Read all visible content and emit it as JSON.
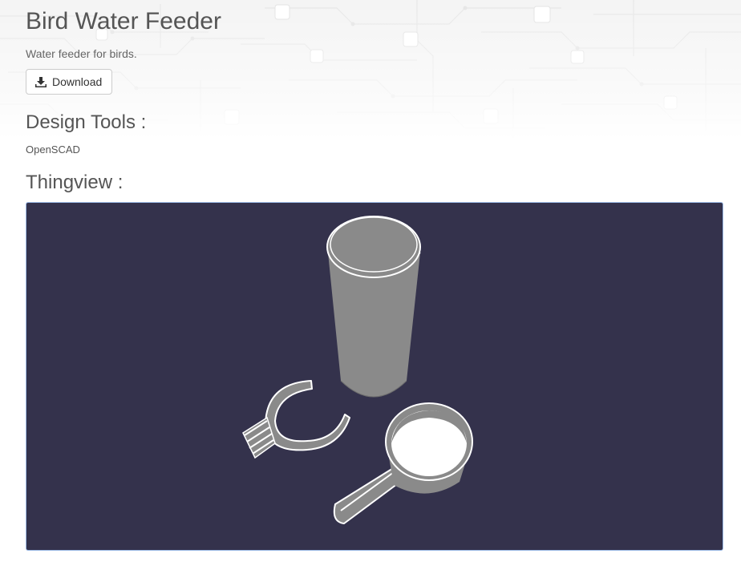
{
  "thing": {
    "title": "Bird Water Feeder",
    "description": "Water feeder for birds.",
    "download_label": "Download"
  },
  "design_tools": {
    "heading": "Design Tools :",
    "items": [
      "OpenSCAD"
    ]
  },
  "thingview": {
    "heading": "Thingview :",
    "background_color": "#34324c",
    "model_color": "#8a8a8a",
    "highlight_color": "#ffffff"
  },
  "icons": {
    "download": "download-icon"
  }
}
